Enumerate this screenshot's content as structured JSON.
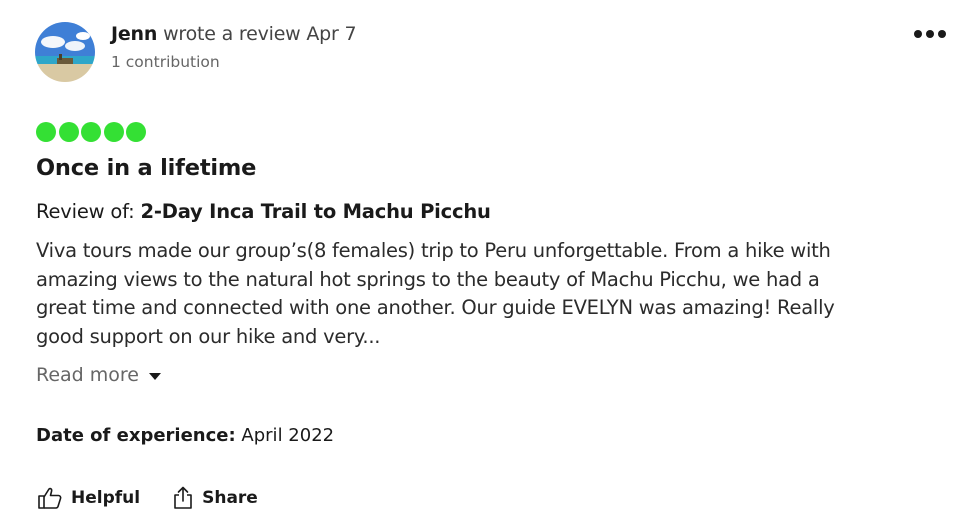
{
  "review": {
    "author": {
      "name": "Jenn",
      "action_text": "wrote a review",
      "date": "Apr 7",
      "contributions": "1 contribution",
      "avatar_icon": "beach-avatar"
    },
    "more_icon": "more-options-icon",
    "rating": {
      "value": 5,
      "max": 5,
      "color": "#34e034"
    },
    "title": "Once in a lifetime",
    "review_of": {
      "label": "Review of:",
      "tour": "2-Day Inca Trail to Machu Picchu"
    },
    "body_lines": [
      "Viva tours made our group’s(8 females) trip to Peru unforgettable. From a hike with",
      "amazing views to the natural hot springs to the beauty of Machu Picchu, we had a",
      "great time and connected with one another. Our guide EVELYN was amazing! Really",
      "good support on our hike and very..."
    ],
    "read_more": "Read more",
    "date_of_experience": {
      "label": "Date of experience:",
      "value": "April 2022"
    },
    "actions": {
      "helpful": "Helpful",
      "share": "Share"
    }
  }
}
